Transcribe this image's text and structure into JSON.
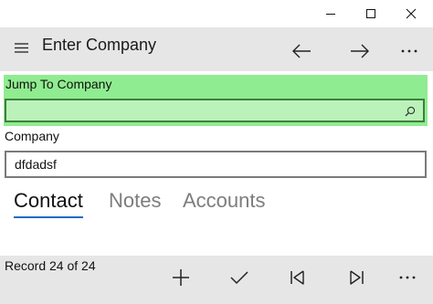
{
  "window": {
    "minimize_icon": "minimize-icon",
    "maximize_icon": "maximize-icon",
    "close_icon": "close-icon"
  },
  "appbar": {
    "menu_icon": "hamburger-icon",
    "title": "Enter Company",
    "back_icon": "arrow-left-icon",
    "forward_icon": "arrow-right-icon",
    "more_icon": "more-icon"
  },
  "jump": {
    "label": "Jump To Company",
    "value": "",
    "search_icon": "search-icon",
    "background": "#90ec90",
    "input_background": "#baf2ba"
  },
  "company": {
    "label": "Company",
    "value": "dfdadsf"
  },
  "tabs": [
    {
      "label": "Contact",
      "active": true
    },
    {
      "label": "Notes",
      "active": false
    },
    {
      "label": "Accounts",
      "active": false
    }
  ],
  "accent_color": "#1a6ec3",
  "bottombar": {
    "record_text": "Record 24 of 24",
    "add_icon": "plus-icon",
    "save_icon": "checkmark-icon",
    "first_icon": "first-record-icon",
    "last_icon": "last-record-icon",
    "more_icon": "more-icon"
  }
}
